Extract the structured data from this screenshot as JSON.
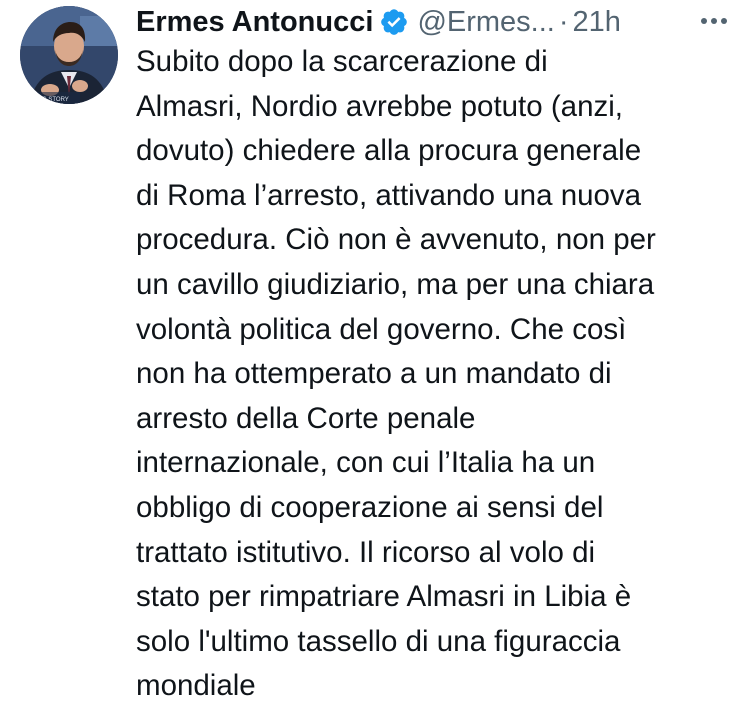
{
  "tweet": {
    "author": {
      "display_name": "Ermes Antonucci",
      "verified": true,
      "verified_icon": "verified-badge-icon",
      "handle": "@Ermes...",
      "avatar_overlay_text": "ESSING STORY"
    },
    "separator": "·",
    "timestamp": "21h",
    "more_icon": "more-horizontal-icon",
    "text_lines": [
      "Subito dopo la scarcerazione di",
      "Almasri, Nordio avrebbe potuto (anzi,",
      "dovuto) chiedere alla procura generale",
      "di Roma l’arresto, attivando una nuova",
      "procedura. Ciò non è avvenuto, non per",
      "un cavillo giudiziario, ma per una chiara",
      "volontà politica del governo. Che così",
      "non ha ottemperato a un mandato di",
      "arresto della Corte penale",
      "internazionale, con cui l’Italia ha un",
      "obbligo di cooperazione ai sensi del",
      "trattato istitutivo. Il ricorso al volo di",
      "stato per rimpatriare Almasri in Libia è",
      "solo l'ultimo tassello di una figuraccia",
      "mondiale"
    ]
  },
  "colors": {
    "text_primary": "#0f1419",
    "text_secondary": "#536471",
    "verified_blue": "#1d9bf0",
    "background": "#ffffff"
  }
}
